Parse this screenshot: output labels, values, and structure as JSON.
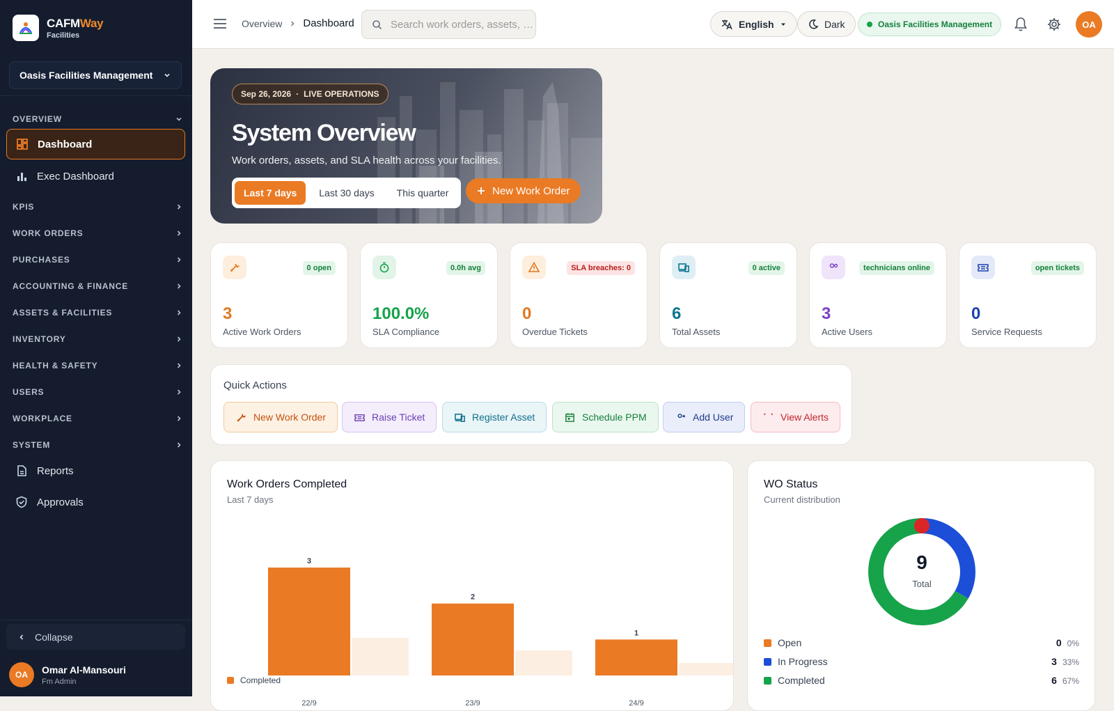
{
  "brand": {
    "name_a": "CAFM",
    "name_b": "Way",
    "subtitle": "Facilities"
  },
  "sidebar": {
    "org_name": "Oasis Facilities Management",
    "section_overview": "OVERVIEW",
    "items": [
      {
        "label": "Dashboard",
        "icon": "dashboard-icon",
        "active": true
      },
      {
        "label": "Exec Dashboard",
        "icon": "bar-chart-icon"
      }
    ],
    "sections": [
      "KPIS",
      "WORK ORDERS",
      "PURCHASES",
      "ACCOUNTING & FINANCE",
      "ASSETS & FACILITIES",
      "INVENTORY",
      "HEALTH & SAFETY",
      "USERS",
      "WORKPLACE",
      "SYSTEM"
    ],
    "bottom_items": [
      {
        "label": "Reports",
        "icon": "report-icon"
      },
      {
        "label": "Approvals",
        "icon": "shield-check-icon"
      }
    ],
    "collapse_label": "Collapse",
    "user": {
      "initials": "OA",
      "name": "Omar Al-Mansouri",
      "role": "Fm Admin"
    }
  },
  "topbar": {
    "breadcrumb_parent": "Overview",
    "breadcrumb_current": "Dashboard",
    "search_placeholder": "Search work orders, assets, …",
    "language": "English",
    "theme_label": "Dark",
    "org_badge": "Oasis Facilities Management",
    "avatar_initials": "OA"
  },
  "hero": {
    "date": "Sep 26, 2026",
    "status": "LIVE OPERATIONS",
    "title": "System Overview",
    "subtitle": "Work orders, assets, and SLA health across your facilities.",
    "ranges": [
      "Last 7 days",
      "Last 30 days",
      "This quarter"
    ],
    "selected_range": "Last 7 days",
    "cta": "New Work Order"
  },
  "kpis": [
    {
      "value": "3",
      "label": "Active Work Orders",
      "badge": "0 open",
      "icon": "wrench-icon",
      "color": "#e07a22"
    },
    {
      "value": "100.0%",
      "label": "SLA Compliance",
      "badge": "0.0h avg",
      "icon": "timer-icon",
      "color": "#16a34a"
    },
    {
      "value": "0",
      "label": "Overdue Tickets",
      "badge": "SLA breaches: 0",
      "icon": "warning-icon",
      "color": "#e07a22"
    },
    {
      "value": "6",
      "label": "Total Assets",
      "badge": "0 active",
      "icon": "devices-icon",
      "color": "#0e7490"
    },
    {
      "value": "3",
      "label": "Active Users",
      "badge": "technicians online",
      "icon": "users-icon",
      "color": "#7e3fc9"
    },
    {
      "value": "0",
      "label": "Service Requests",
      "badge": "open tickets",
      "icon": "ticket-icon",
      "color": "#1e40af"
    }
  ],
  "quick_actions": {
    "title": "Quick Actions",
    "buttons": [
      "New Work Order",
      "Raise Ticket",
      "Register Asset",
      "Schedule PPM",
      "Add User",
      "View Alerts"
    ]
  },
  "wo_chart": {
    "title": "Work Orders Completed",
    "subtitle": "Last 7 days",
    "legend": "Completed"
  },
  "chart_data": {
    "type": "bar",
    "categories": [
      "22/9",
      "23/9",
      "24/9"
    ],
    "series": [
      {
        "name": "Completed",
        "values": [
          3,
          2,
          1
        ]
      }
    ],
    "ylim": [
      0,
      3
    ],
    "title": "Work Orders Completed",
    "subtitle": "Last 7 days",
    "color": "#ea7a24"
  },
  "status_chart": {
    "title": "WO Status",
    "subtitle": "Current distribution",
    "total": "9",
    "total_label": "Total",
    "items": [
      {
        "label": "Open",
        "count": "0",
        "pct": "0%",
        "color": "#ea7a24"
      },
      {
        "label": "In Progress",
        "count": "3",
        "pct": "33%",
        "color": "#1d4ed8"
      },
      {
        "label": "Completed",
        "count": "6",
        "pct": "67%",
        "color": "#16a34a"
      }
    ]
  }
}
